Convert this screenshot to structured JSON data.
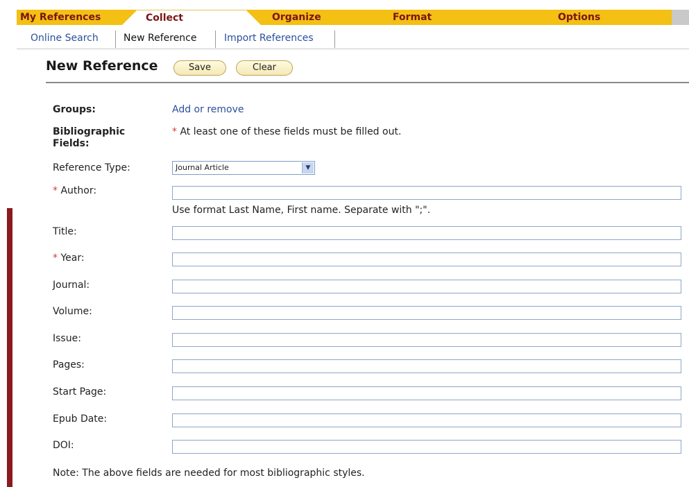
{
  "tabs": [
    {
      "label": "My References"
    },
    {
      "label": "Collect"
    },
    {
      "label": "Organize"
    },
    {
      "label": "Format"
    },
    {
      "label": "Options"
    }
  ],
  "subnav": {
    "online_search": "Online Search",
    "new_reference": "New Reference",
    "import_references": "Import References"
  },
  "header": {
    "title": "New Reference",
    "save_label": "Save",
    "clear_label": "Clear"
  },
  "form": {
    "groups_label": "Groups:",
    "groups_link": "Add or remove",
    "biblio_label_1": "Bibliographic",
    "biblio_label_2": "Fields:",
    "required_marker": "*",
    "required_note": "At least one of these fields must be filled out.",
    "reference_type_label": "Reference Type:",
    "reference_type_value": "Journal Article",
    "author_label": "Author:",
    "author_hint": "Use format Last Name, First name. Separate with \";\".",
    "title_label": "Title:",
    "year_label": "Year:",
    "journal_label": "Journal:",
    "volume_label": "Volume:",
    "issue_label": "Issue:",
    "pages_label": "Pages:",
    "start_page_label": "Start Page:",
    "epub_date_label": "Epub Date:",
    "doi_label": "DOI:",
    "footer_note": "Note: The above fields are needed for most bibliographic styles."
  },
  "icons": {
    "dropdown": "chevron-down-icon"
  },
  "colors": {
    "tab_yellow": "#f3c013",
    "tab_text": "#7a1515",
    "link_blue": "#2a4f9c",
    "required_red": "#d23a3a",
    "left_stripe": "#8b1a1f"
  }
}
